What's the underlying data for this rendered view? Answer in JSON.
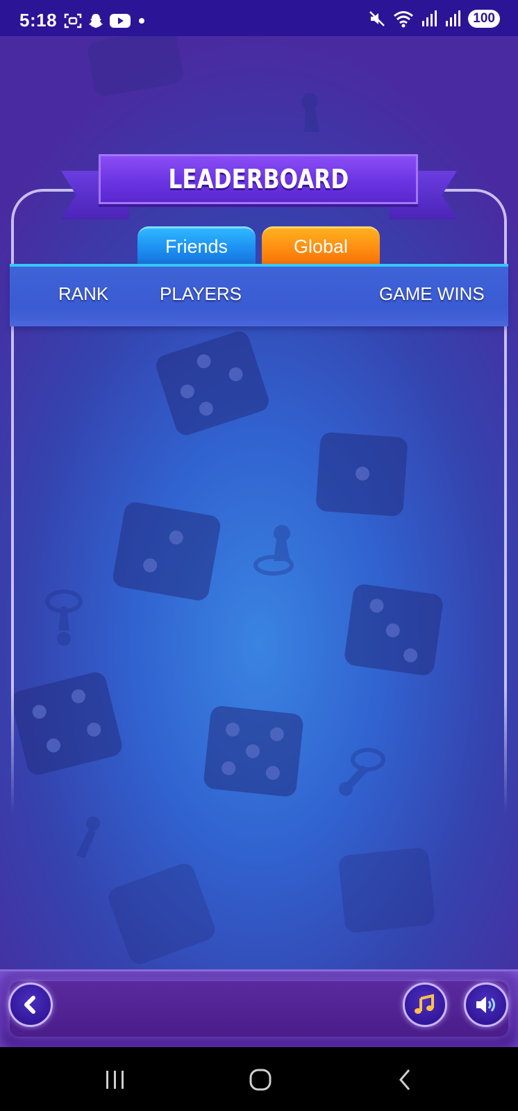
{
  "status_bar": {
    "time": "5:18",
    "battery": "100",
    "left_icons": [
      "screenshot-icon",
      "snapchat-icon",
      "youtube-icon",
      "dot-icon"
    ],
    "right_icons": [
      "mute-icon",
      "wifi-icon",
      "signal-icon",
      "signal-icon"
    ]
  },
  "leaderboard": {
    "title": "LEADERBOARD",
    "tabs": [
      {
        "label": "Friends",
        "color": "#1b8cf0"
      },
      {
        "label": "Global",
        "color": "#ff8a10",
        "selected": true
      }
    ],
    "columns": [
      "RANK",
      "PLAYERS",
      "GAME WINS"
    ]
  },
  "bottom_bar": {
    "buttons": [
      "back-icon",
      "music-icon",
      "sound-icon"
    ]
  },
  "nav": {
    "buttons": [
      "recents-icon",
      "home-icon",
      "back-icon"
    ]
  },
  "colors": {
    "accent_cyan": "#35c8ff",
    "ribbon_purple": "#6b34e3",
    "status_bar": "#2c1497"
  }
}
